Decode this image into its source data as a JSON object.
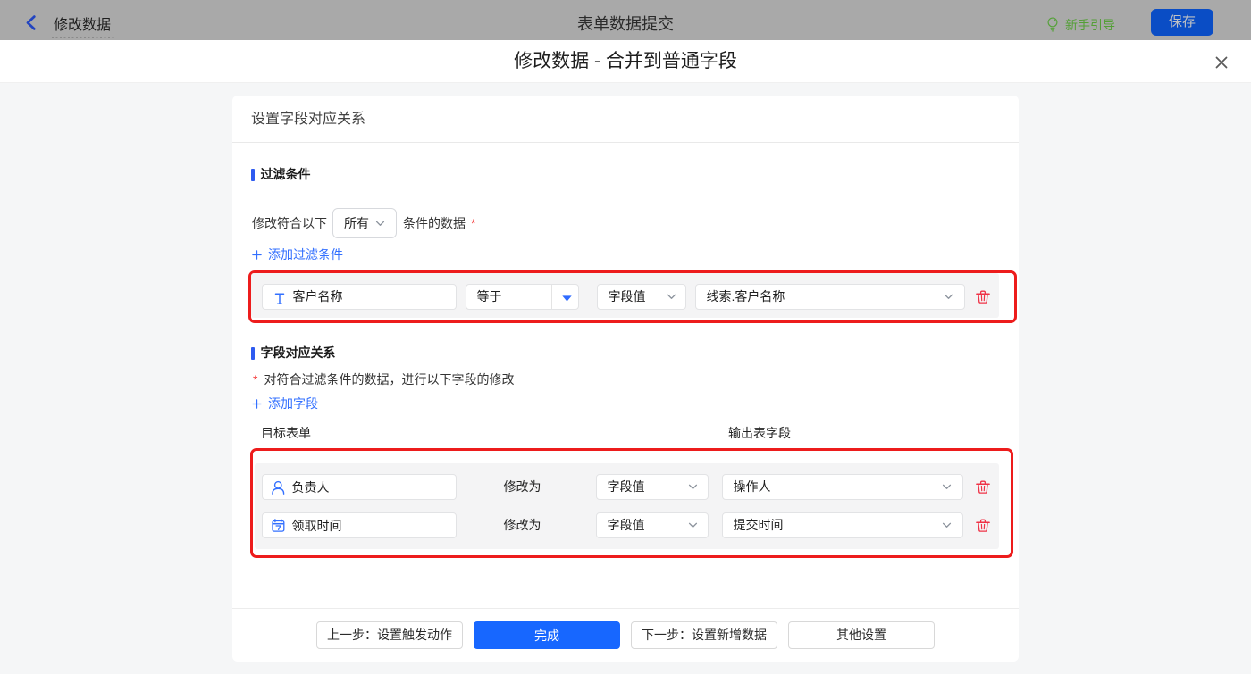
{
  "topbar": {
    "back_label": "修改数据",
    "center_title": "表单数据提交",
    "guide_label": "新手引导",
    "save_label": "保存"
  },
  "dialog": {
    "title": "修改数据 - 合并到普通字段"
  },
  "panel": {
    "header_title": "设置字段对应关系",
    "filter": {
      "section_title": "过滤条件",
      "match_prefix": "修改符合以下",
      "match_select_value": "所有",
      "match_suffix": "条件的数据",
      "required_mark": "*",
      "add_link": "添加过滤条件",
      "row": {
        "field": "客户名称",
        "field_icon": "text-field-icon",
        "operator": "等于",
        "value_type": "字段值",
        "value": "线索.客户名称"
      }
    },
    "mapping": {
      "section_title": "字段对应关系",
      "required_mark": "*",
      "note": "对符合过滤条件的数据，进行以下字段的修改",
      "add_link": "添加字段",
      "col_left": "目标表单",
      "col_right": "输出表字段",
      "rows": [
        {
          "field": "负责人",
          "field_icon": "person-icon",
          "modify_label": "修改为",
          "value_type": "字段值",
          "value": "操作人"
        },
        {
          "field": "领取时间",
          "field_icon": "calendar-icon",
          "modify_label": "修改为",
          "value_type": "字段值",
          "value": "提交时间"
        }
      ]
    },
    "footer": {
      "prev_label": "上一步：设置触发动作",
      "done_label": "完成",
      "next_label": "下一步：设置新增数据",
      "other_label": "其他设置"
    }
  },
  "colors": {
    "accent_blue": "#3370ff",
    "primary_button_blue": "#1767ff",
    "dimmed_save_blue": "#0a4dc5",
    "highlight_red": "#ed1c1c",
    "trash_red": "#ef3347",
    "guide_green": "#55a139",
    "topbar_gray": "#a9a9a9",
    "row_fill_gray": "#f4f4f5"
  }
}
